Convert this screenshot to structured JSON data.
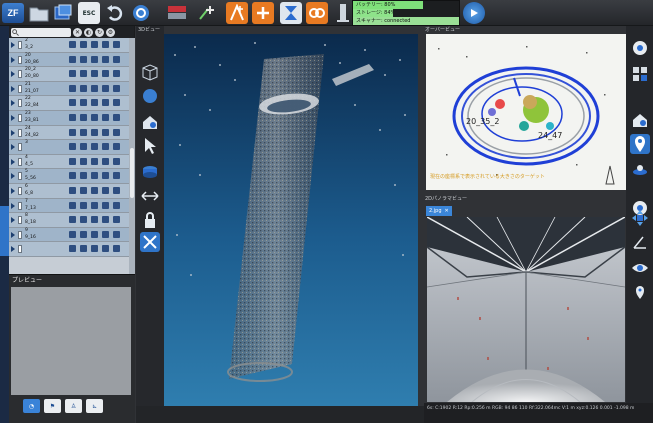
{
  "toolbar": {
    "logo_text": "ZF",
    "esc_label": "ESC",
    "status_lines": [
      "バッテリー: 80%",
      "ストレージ: 84%",
      "スキャナー: connected"
    ]
  },
  "layers": {
    "rows": [
      {
        "name": "2",
        "sub": "3_2"
      },
      {
        "name": "20",
        "sub": "20_86"
      },
      {
        "name": "20_2",
        "sub": "20_80"
      },
      {
        "name": "21",
        "sub": "21_07"
      },
      {
        "name": "22",
        "sub": "22_84"
      },
      {
        "name": "23",
        "sub": "23_81"
      },
      {
        "name": "24",
        "sub": "24_82"
      },
      {
        "name": "3",
        "sub": ""
      },
      {
        "name": "4",
        "sub": "4_5"
      },
      {
        "name": "5",
        "sub": "5_56"
      },
      {
        "name": "6",
        "sub": "6_8"
      },
      {
        "name": "7",
        "sub": "7_13"
      },
      {
        "name": "8",
        "sub": "8_18"
      },
      {
        "name": "9",
        "sub": "9_16"
      },
      {
        "name": "",
        "sub": ""
      }
    ]
  },
  "preview": {
    "title": "プレビュー"
  },
  "view3d": {
    "title": "3Dビュー"
  },
  "overview": {
    "title": "オーバービュー",
    "caption": "現在の座標系で表示されている大きさのターゲット",
    "label_a": "20_35_2",
    "label_b": "24_47"
  },
  "view2d": {
    "title": "2Dパノラマビュー",
    "tab": "2.jpg"
  },
  "footer": {
    "status": "6s: C:1902 R:12 Rp:0.256 m RGB: 94 86 110 Rf:322.064mc V:1 m xyz:0.126 0.001 -1.098 m"
  },
  "colors": {
    "accent": "#2f74c8",
    "overview_ring": "#1f3fd6",
    "status_green": "#7fe07a"
  }
}
